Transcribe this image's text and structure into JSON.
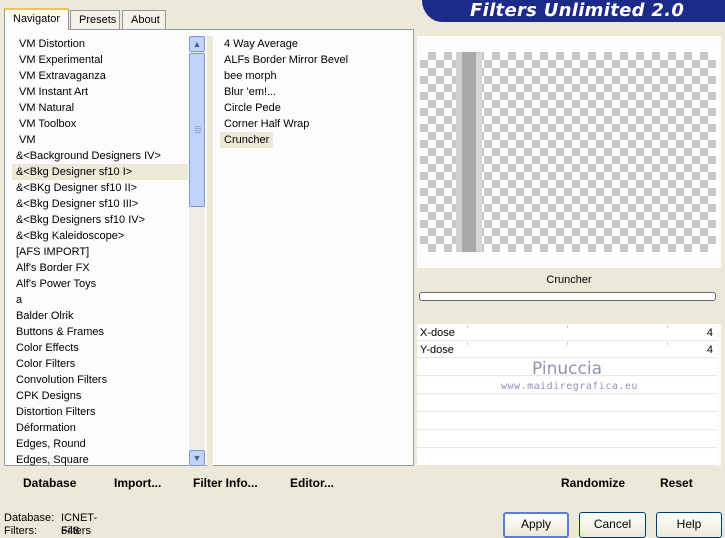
{
  "app": {
    "title": "Filters Unlimited 2.0"
  },
  "tabs": [
    {
      "label": "Navigator",
      "active": true
    },
    {
      "label": "Presets",
      "active": false
    },
    {
      "label": "About",
      "active": false
    }
  ],
  "categories": {
    "items": [
      "VM Distortion",
      "VM Experimental",
      "VM Extravaganza",
      "VM Instant Art",
      "VM Natural",
      "VM Toolbox",
      "VM",
      "&<Background Designers IV>",
      "&<Bkg Designer sf10 I>",
      "&<BKg Designer sf10 II>",
      "&<Bkg Designer sf10 III>",
      "&<Bkg Designers sf10 IV>",
      "&<Bkg Kaleidoscope>",
      "[AFS IMPORT]",
      "Alf's Border FX",
      "Alf's Power Toys",
      "a",
      "Balder Olrik",
      "Buttons & Frames",
      "Color Effects",
      "Color Filters",
      "Convolution Filters",
      "CPK Designs",
      "Distortion Filters",
      "Déformation",
      "Edges, Round",
      "Edges, Square"
    ],
    "selected_index": 8
  },
  "filters": {
    "items": [
      "4 Way Average",
      "ALFs Border Mirror Bevel",
      "bee morph",
      "Blur 'em!...",
      "Circle Pede",
      "Corner Half Wrap",
      "Cruncher"
    ],
    "selected_index": 6
  },
  "preview": {
    "filter_name": "Cruncher",
    "progress_fraction": 0
  },
  "params": [
    {
      "label": "X-dose",
      "value": "4"
    },
    {
      "label": "Y-dose",
      "value": "4"
    }
  ],
  "watermark": {
    "name": "Pinuccia",
    "url": "www.maidiregrafica.eu"
  },
  "toolbar_left": {
    "database": "Database",
    "import": "Import...",
    "filter_info": "Filter Info...",
    "editor": "Editor..."
  },
  "toolbar_right": {
    "randomize": "Randomize",
    "reset": "Reset"
  },
  "status": {
    "database_label": "Database:",
    "database_value": "ICNET-Filters",
    "filters_label": "Filters:",
    "filters_value": "648"
  },
  "buttons": {
    "apply": "Apply",
    "cancel": "Cancel",
    "help": "Help"
  },
  "colors": {
    "window_bg": "#ece9d8",
    "banner_bg": "#1c2a8a",
    "tab_highlight": "#ffc83c"
  }
}
